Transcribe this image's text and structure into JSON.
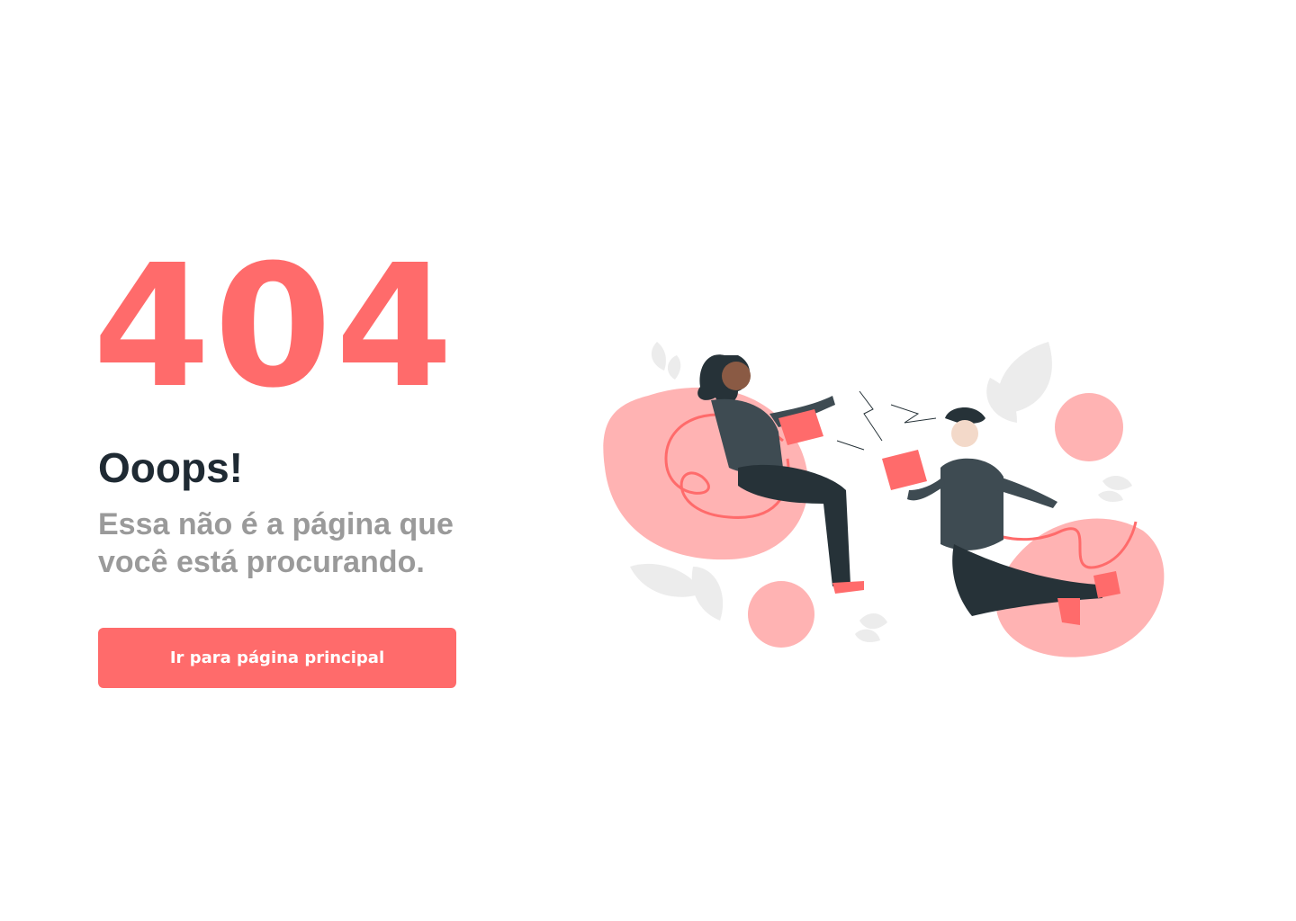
{
  "error": {
    "code": "404",
    "title": "Ooops!",
    "message": "Essa não é a página que você está procurando.",
    "button_label": "Ir para página principal"
  },
  "colors": {
    "accent": "#ff6b6b",
    "blob": "#ffb3b3",
    "title": "#1f2a33",
    "message": "#9a9a9a",
    "leaf": "#ececec",
    "clothing": "#3e4b52",
    "dark": "#263238"
  },
  "illustration": {
    "icon": "unplugged-people-illustration"
  }
}
